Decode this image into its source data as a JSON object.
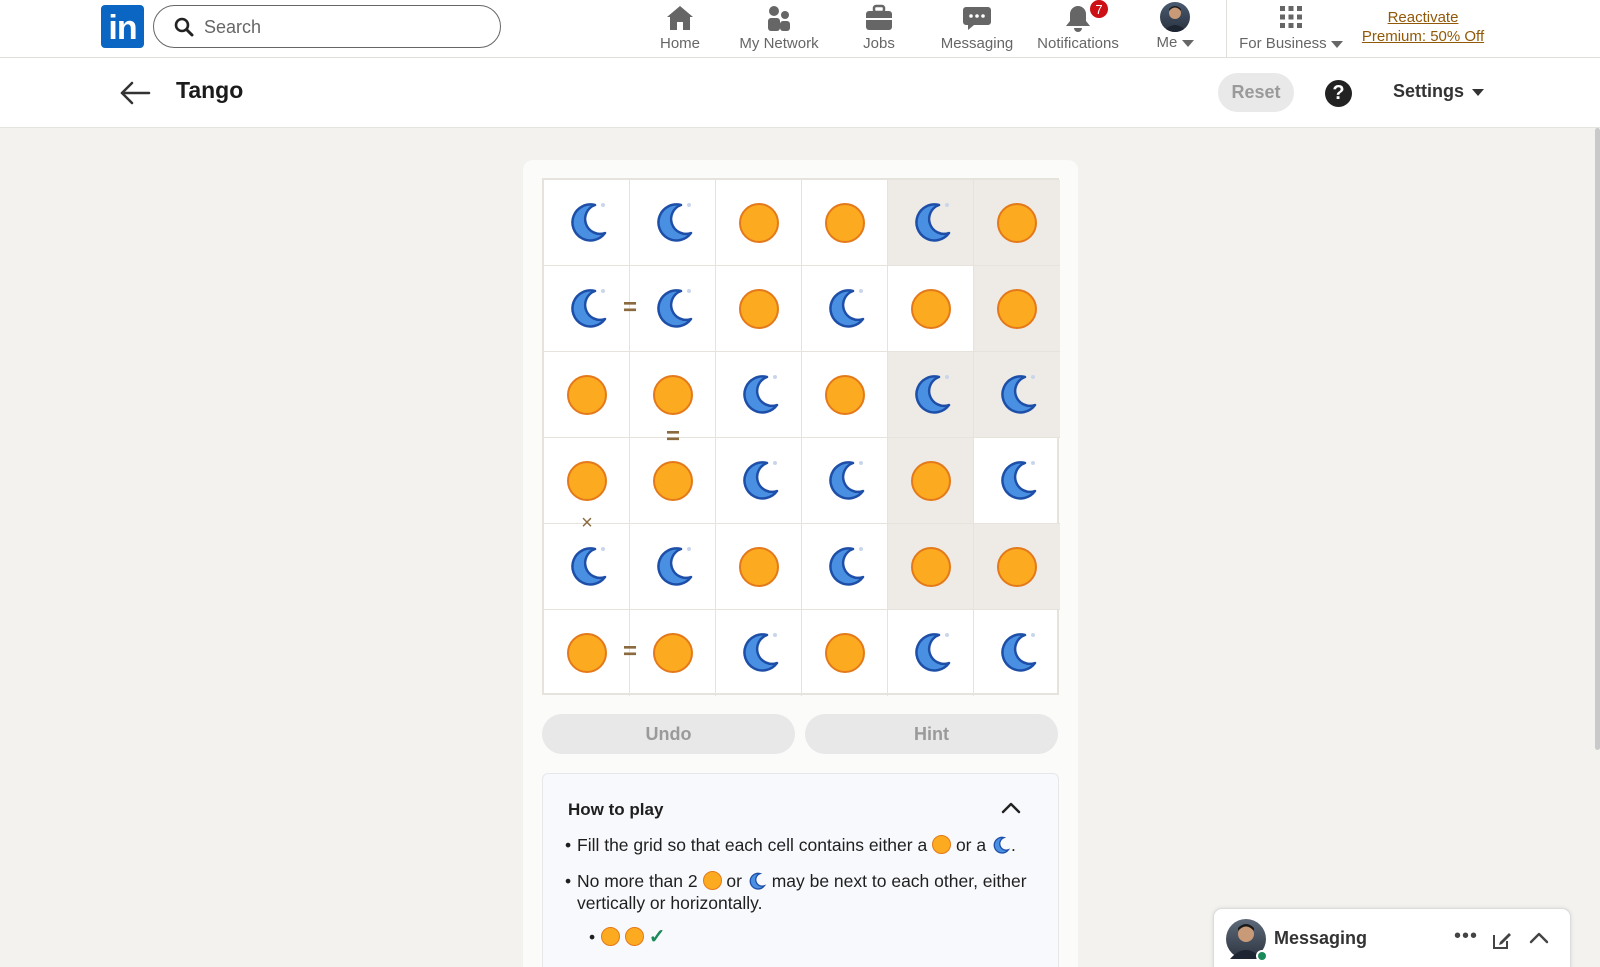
{
  "nav": {
    "search_placeholder": "Search",
    "items": [
      {
        "label": "Home",
        "icon": "home-icon"
      },
      {
        "label": "My Network",
        "icon": "network-icon"
      },
      {
        "label": "Jobs",
        "icon": "briefcase-icon"
      },
      {
        "label": "Messaging",
        "icon": "chat-icon"
      },
      {
        "label": "Notifications",
        "icon": "bell-icon",
        "badge": "7"
      },
      {
        "label": "Me",
        "icon": "avatar"
      },
      {
        "label": "For Business",
        "icon": "grid-icon"
      }
    ],
    "premium_line1": "Reactivate",
    "premium_line2": "Premium: 50% Off"
  },
  "header": {
    "title": "Tango",
    "reset_label": "Reset",
    "help_label": "?",
    "settings_label": "Settings"
  },
  "board": {
    "size": 6,
    "grid": [
      [
        "moon",
        "moon",
        "sun",
        "sun",
        "moon",
        "sun"
      ],
      [
        "moon",
        "moon",
        "sun",
        "moon",
        "sun",
        "sun"
      ],
      [
        "sun",
        "sun",
        "moon",
        "sun",
        "moon",
        "moon"
      ],
      [
        "sun",
        "sun",
        "moon",
        "moon",
        "sun",
        "moon"
      ],
      [
        "moon",
        "moon",
        "sun",
        "moon",
        "sun",
        "sun"
      ],
      [
        "sun",
        "sun",
        "moon",
        "sun",
        "moon",
        "moon"
      ]
    ],
    "locked": [
      [
        0,
        4
      ],
      [
        0,
        5
      ],
      [
        1,
        5
      ],
      [
        2,
        4
      ],
      [
        2,
        5
      ],
      [
        3,
        4
      ],
      [
        4,
        4
      ],
      [
        4,
        5
      ]
    ],
    "constraints": [
      {
        "type": "equal",
        "symbol": "=",
        "between": [
          [
            1,
            0
          ],
          [
            1,
            1
          ]
        ]
      },
      {
        "type": "equal",
        "symbol": "=",
        "between": [
          [
            2,
            1
          ],
          [
            3,
            1
          ]
        ]
      },
      {
        "type": "opposite",
        "symbol": "×",
        "between": [
          [
            3,
            0
          ],
          [
            4,
            0
          ]
        ]
      },
      {
        "type": "equal",
        "symbol": "=",
        "between": [
          [
            5,
            0
          ],
          [
            5,
            1
          ]
        ]
      }
    ]
  },
  "controls": {
    "undo_label": "Undo",
    "hint_label": "Hint"
  },
  "howto": {
    "title": "How to play",
    "rule1_a": "Fill the grid so that each cell contains either a",
    "rule1_b": "or a",
    "rule1_c": ".",
    "rule2_a": "No more than 2",
    "rule2_b": "or",
    "rule2_c": "may be next to each other, either",
    "rule2_d": "vertically or horizontally.",
    "example_mark": "✓"
  },
  "messaging": {
    "label": "Messaging",
    "dots": "•••"
  },
  "colors": {
    "brand": "#0a66c2",
    "sun_fill": "#fcaa1f",
    "sun_stroke": "#e3791a",
    "moon_fill": "#4a90e2",
    "moon_stroke": "#1e4fa8",
    "locked_cell": "#eeebe6",
    "premium": "#915907",
    "badge": "#cc1016"
  }
}
